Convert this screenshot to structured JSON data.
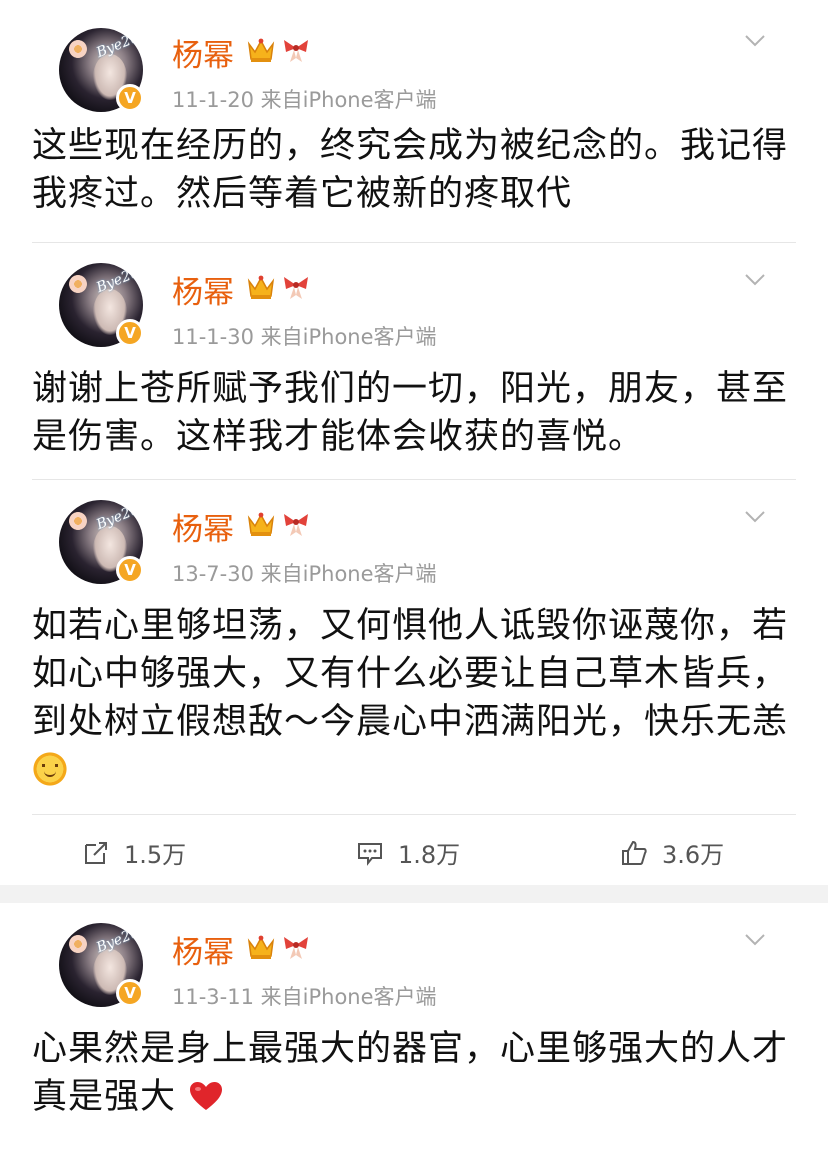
{
  "posts": [
    {
      "author": "杨幂",
      "meta": "11-1-20  来自iPhone客户端",
      "text": "这些现在经历的，终究会成为被纪念的。我记得我疼过。然后等着它被新的疼取代"
    },
    {
      "author": "杨幂",
      "meta": "11-1-30  来自iPhone客户端",
      "text": "谢谢上苍所赋予我们的一切，阳光，朋友，甚至是伤害。这样我才能体会收获的喜悦。"
    },
    {
      "author": "杨幂",
      "meta": "13-7-30  来自iPhone客户端",
      "text": "如若心里够坦荡，又何惧他人诋毁你诬蔑你，若如心中够强大，又有什么必要让自己草木皆兵，到处树立假想敌～今晨心中洒满阳光，快乐无恙",
      "emoji": "smiling-sun-emoji",
      "actions": {
        "repost": "1.5万",
        "comment": "1.8万",
        "like": "3.6万"
      }
    },
    {
      "author": "杨幂",
      "meta": "11-3-11  来自iPhone客户端",
      "text": "心果然是身上最强大的器官，心里够强大的人才真是强大",
      "emoji": "red-heart-emoji"
    }
  ],
  "avatar_caption": "Bye2020",
  "verified_badge": "V",
  "colors": {
    "author_name": "#e8600e",
    "meta_text": "#9a9a9a",
    "verified_badge": "#f5a623"
  }
}
